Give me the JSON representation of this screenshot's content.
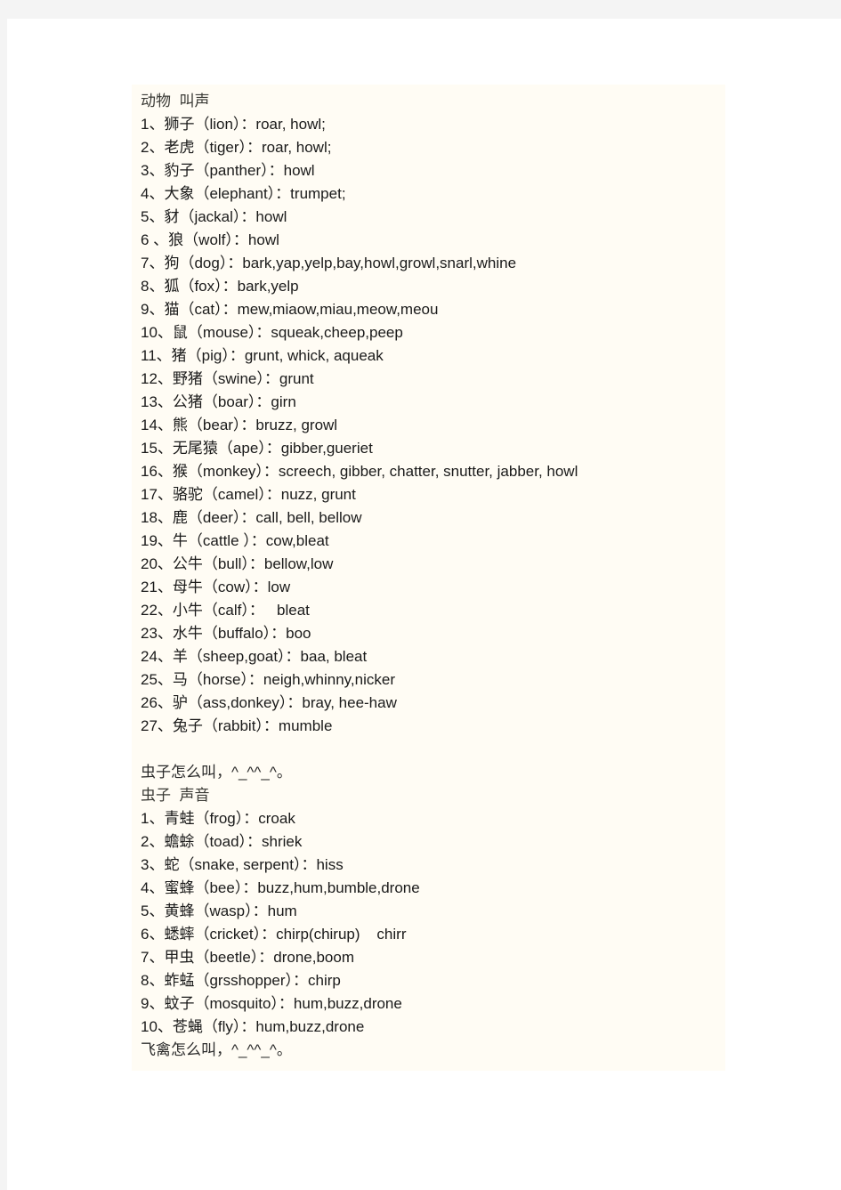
{
  "document": {
    "sections": [
      {
        "id": "animals",
        "heading": "动物  叫声",
        "entries": [
          "1、狮子（lion）：roar, howl;",
          "2、老虎（tiger）：roar, howl;",
          "3、豹子（panther）：howl",
          "4、大象（elephant）：trumpet;",
          "5、豺（jackal）：howl",
          "6 、狼（wolf）：howl",
          "7、狗（dog）：bark,yap,yelp,bay,howl,growl,snarl,whine",
          "8、狐（fox）：bark,yelp",
          "9、猫（cat）：mew,miaow,miau,meow,meou",
          "10、鼠（mouse）：squeak,cheep,peep",
          "11、猪（pig）：grunt, whick, aqueak",
          "12、野猪（swine）：grunt",
          "13、公猪（boar）：girn",
          "14、熊（bear）：bruzz, growl",
          "15、无尾猿（ape）：gibber,gueriet",
          "16、猴（monkey）：screech, gibber, chatter, snutter, jabber, howl",
          "17、骆驼（camel）：nuzz, grunt",
          "18、鹿（deer）：call, bell, bellow",
          "19、牛（cattle ）：cow,bleat",
          "20、公牛（bull）：bellow,low",
          "21、母牛（cow）：low",
          "22、小牛（calf）：   bleat",
          "23、水牛（buffalo）：boo",
          "24、羊（sheep,goat）：baa, bleat",
          "25、马（horse）：neigh,whinny,nicker",
          "26、驴（ass,donkey）：bray, hee-haw",
          "27、兔子（rabbit）：mumble"
        ]
      },
      {
        "id": "insects",
        "note_before": "虫子怎么叫，^_^^_^。",
        "heading": "虫子  声音",
        "entries": [
          "1、青蛙（frog）：croak",
          "2、蟾蜍（toad）：shriek",
          "3、蛇（snake, serpent）：hiss",
          "4、蜜蜂（bee）：buzz,hum,bumble,drone",
          "5、黄蜂（wasp）：hum",
          "6、蟋蟀（cricket）：chirp(chirup)    chirr",
          "7、甲虫（beetle）：drone,boom",
          "8、蚱蜢（grsshopper）：chirp",
          "9、蚊子（mosquito）：hum,buzz,drone",
          "10、苍蝇（fly）：hum,buzz,drone"
        ]
      }
    ],
    "footer_note": "飞禽怎么叫，^_^^_^。"
  },
  "colors": {
    "outer_background": "#f4f4f4",
    "page_background": "#ffffff",
    "content_block_background": "#fffcf4",
    "body_text": "#1a1a1a",
    "heading_text": "#3a3a35"
  }
}
